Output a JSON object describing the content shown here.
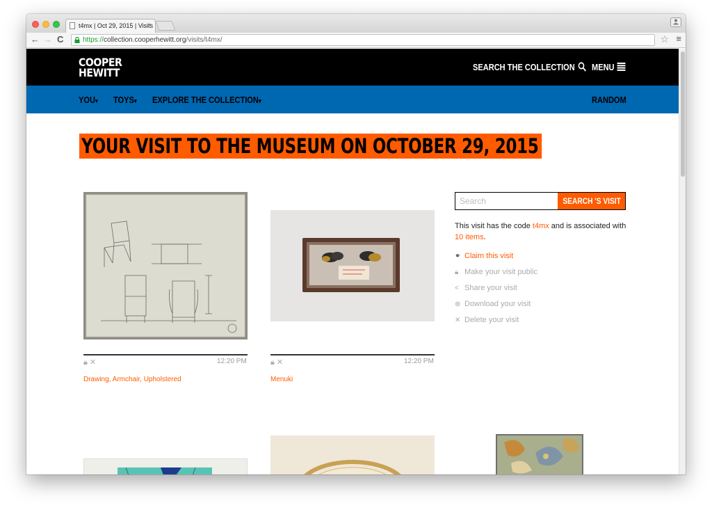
{
  "browser": {
    "tab_title": "t4mx | Oct 29, 2015 | Visits",
    "tab_close": "×",
    "url_scheme": "https://",
    "url_host": "collection.cooperhewitt.org",
    "url_path": "/visits/t4mx/",
    "back": "←",
    "forward": "→",
    "reload": "C",
    "bookmark": "☆",
    "menu": "≡"
  },
  "header": {
    "logo_line1": "COOPER",
    "logo_line2": "HEWITT",
    "search_label": "SEARCH THE COLLECTION",
    "menu_label": "MENU"
  },
  "subnav": {
    "you": "YOU",
    "toys": "TOYS",
    "explore": "EXPLORE THE COLLECTION",
    "random": "RANDOM",
    "caret": "▾"
  },
  "page": {
    "title": "YOUR VISIT TO THE MUSEUM ON OCTOBER 29, 2015"
  },
  "cards": [
    {
      "title": "Drawing, Armchair, Upholstered",
      "time": "12:20 PM"
    },
    {
      "title": "Menuki",
      "time": "12:20 PM"
    }
  ],
  "sidebar": {
    "search_placeholder": "Search",
    "search_button": "SEARCH 'S VISIT",
    "desc_prefix": "This visit has the code ",
    "code": "t4mx",
    "desc_middle": " and is associated with ",
    "items": "10 items",
    "desc_suffix": ".",
    "actions": [
      {
        "icon": "link-icon",
        "label": "Claim this visit"
      },
      {
        "icon": "lock-icon",
        "label": "Make your visit public"
      },
      {
        "icon": "share-icon",
        "label": "Share your visit"
      },
      {
        "icon": "download-icon",
        "label": "Download your visit"
      },
      {
        "icon": "delete-icon",
        "label": "Delete your visit"
      }
    ]
  },
  "colors": {
    "accent": "#ff5b00",
    "nav_blue": "#0067b1",
    "header_black": "#000000"
  }
}
